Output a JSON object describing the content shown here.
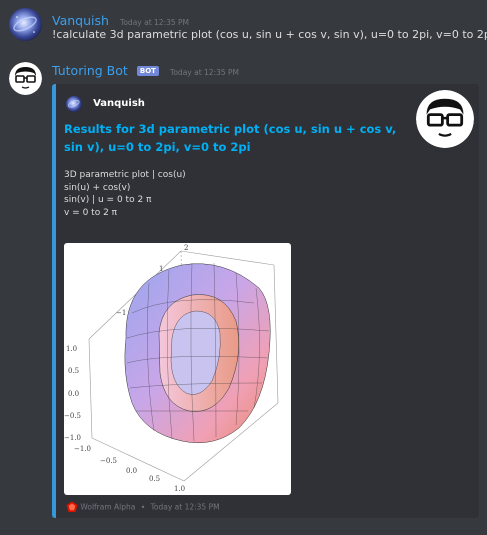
{
  "messages": [
    {
      "author": "Vanquish",
      "timestamp": "Today at 12:35 PM",
      "content": "!calculate 3d parametric plot (cos u, sin u + cos v, sin v), u=0 to 2pi, v=0 to 2pi",
      "avatar_icon": "galaxy-avatar-icon"
    },
    {
      "author": "Tutoring Bot",
      "badge": "BOT",
      "timestamp": "Today at 12:35 PM",
      "avatar_icon": "glasses-face-icon",
      "embed": {
        "accent_color": "#3498db",
        "author_name": "Vanquish",
        "title": "Results for 3d parametric plot (cos u, sin u + cos v, sin v), u=0 to 2pi, v=0 to 2pi",
        "description_lines": [
          "3D parametric plot | cos(u)",
          "sin(u) + cos(v)",
          "sin(v) | u = 0 to 2 π",
          "v = 0 to 2 π"
        ],
        "plot_ticks": {
          "top": [
            "2",
            "1"
          ],
          "upper_left": [
            "−1"
          ],
          "left": [
            "1.0",
            "0.5",
            "0.0",
            "−0.5",
            "−1.0"
          ],
          "bottom": [
            "−1.0",
            "−0.5",
            "0.0",
            "0.5",
            "1.0"
          ]
        },
        "footer": {
          "provider": "Wolfram Alpha",
          "separator": "•",
          "timestamp": "Today at 12:35 PM"
        }
      }
    }
  ],
  "colors": {
    "background": "#36393e",
    "username": "#3aa0f0",
    "embed_title": "#00b0f4",
    "bot_badge": "#7289da"
  }
}
